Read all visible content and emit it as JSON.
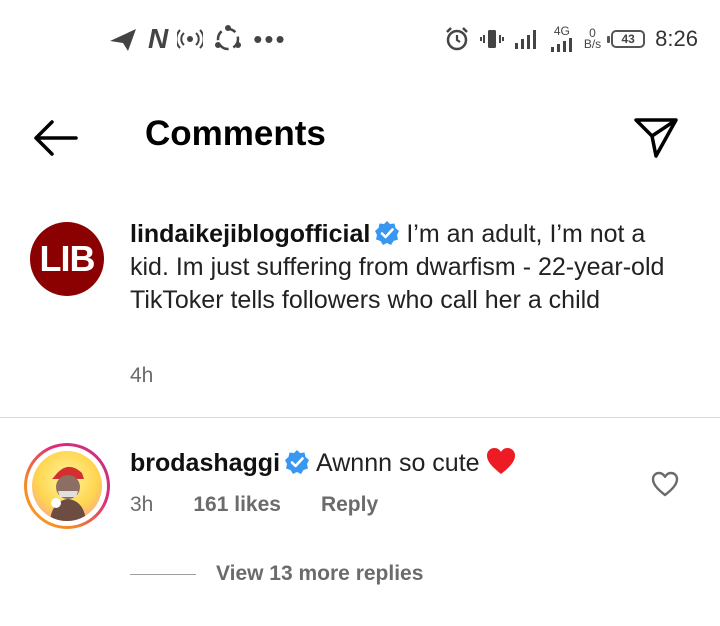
{
  "status_bar": {
    "net_speed_value": "0",
    "net_speed_unit": "B/s",
    "network_type": "4G",
    "battery": "43",
    "time": "8:26"
  },
  "header": {
    "title": "Comments"
  },
  "caption": {
    "avatar_text": "LIB",
    "username": "lindaikejiblogofficial",
    "text": "I’m an adult, I’m not a kid. Im just suffering from dwarfism - 22-year-old TikToker tells followers who call her a child",
    "time": "4h"
  },
  "comment": {
    "username": "brodashaggi",
    "text": "Awnnn so cute",
    "time": "3h",
    "likes": "161 likes",
    "reply_label": "Reply"
  },
  "view_replies": {
    "label": "View 13 more replies"
  },
  "colors": {
    "verified_blue": "#3897f0",
    "heart_red": "#ed1c24",
    "lib_red": "#8b0000"
  }
}
